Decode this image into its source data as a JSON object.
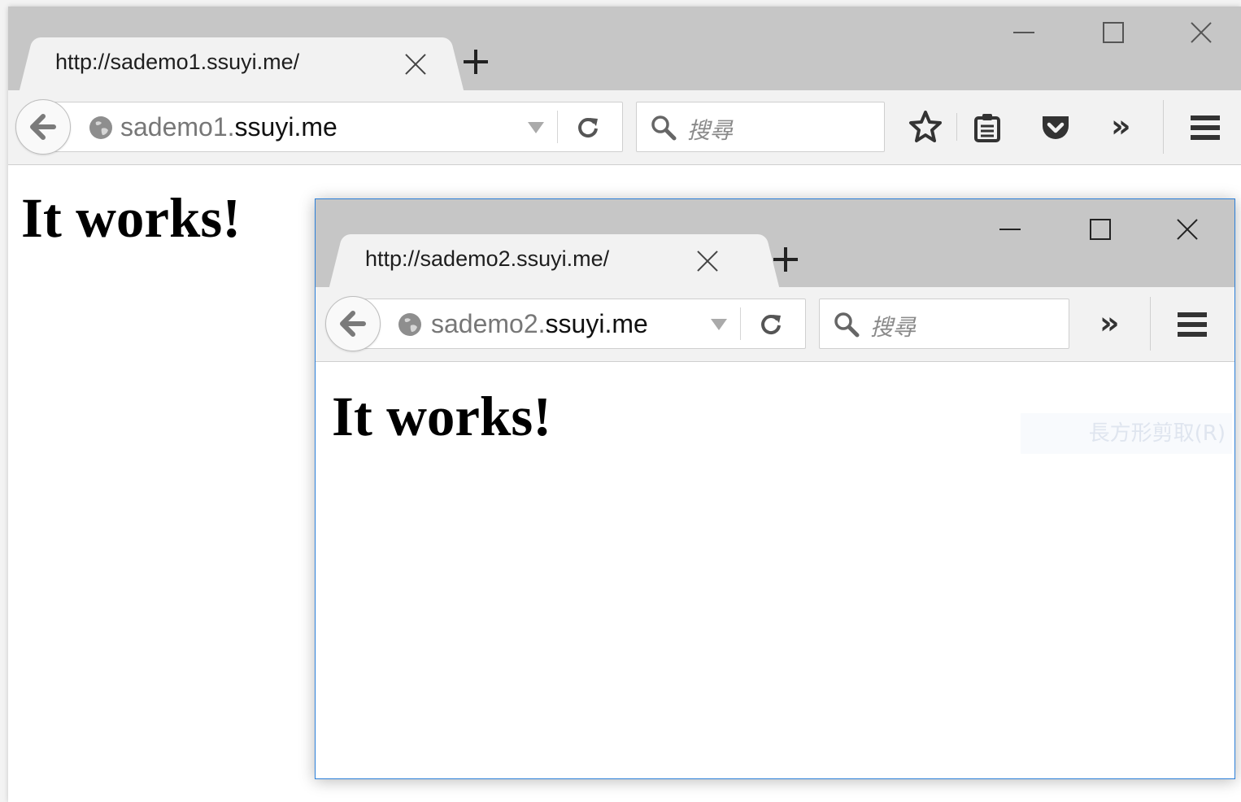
{
  "window_main": {
    "tab_title": "http://sademo1.ssuyi.me/",
    "url_subdomain": "sademo1.",
    "url_domain": "ssuyi.me",
    "search_placeholder": "搜尋",
    "overflow_label": "»",
    "page_heading": "It works!"
  },
  "window_popup": {
    "tab_title": "http://sademo2.ssuyi.me/",
    "url_subdomain": "sademo2.",
    "url_domain": "ssuyi.me",
    "search_placeholder": "搜尋",
    "overflow_label": "»",
    "page_heading": "It works!",
    "snip_hint": "長方形剪取(R)"
  },
  "icons": [
    "back-arrow-icon",
    "globe-icon",
    "dropdown-icon",
    "reload-icon",
    "search-icon",
    "star-icon",
    "reading-list-icon",
    "pocket-icon",
    "hamburger-menu-icon",
    "minimize-icon",
    "maximize-icon",
    "close-icon",
    "new-tab-icon"
  ],
  "colors": {
    "tabstrip": "#c6c6c6",
    "toolbar": "#f2f2f2",
    "active_border": "#2b7fd9"
  }
}
